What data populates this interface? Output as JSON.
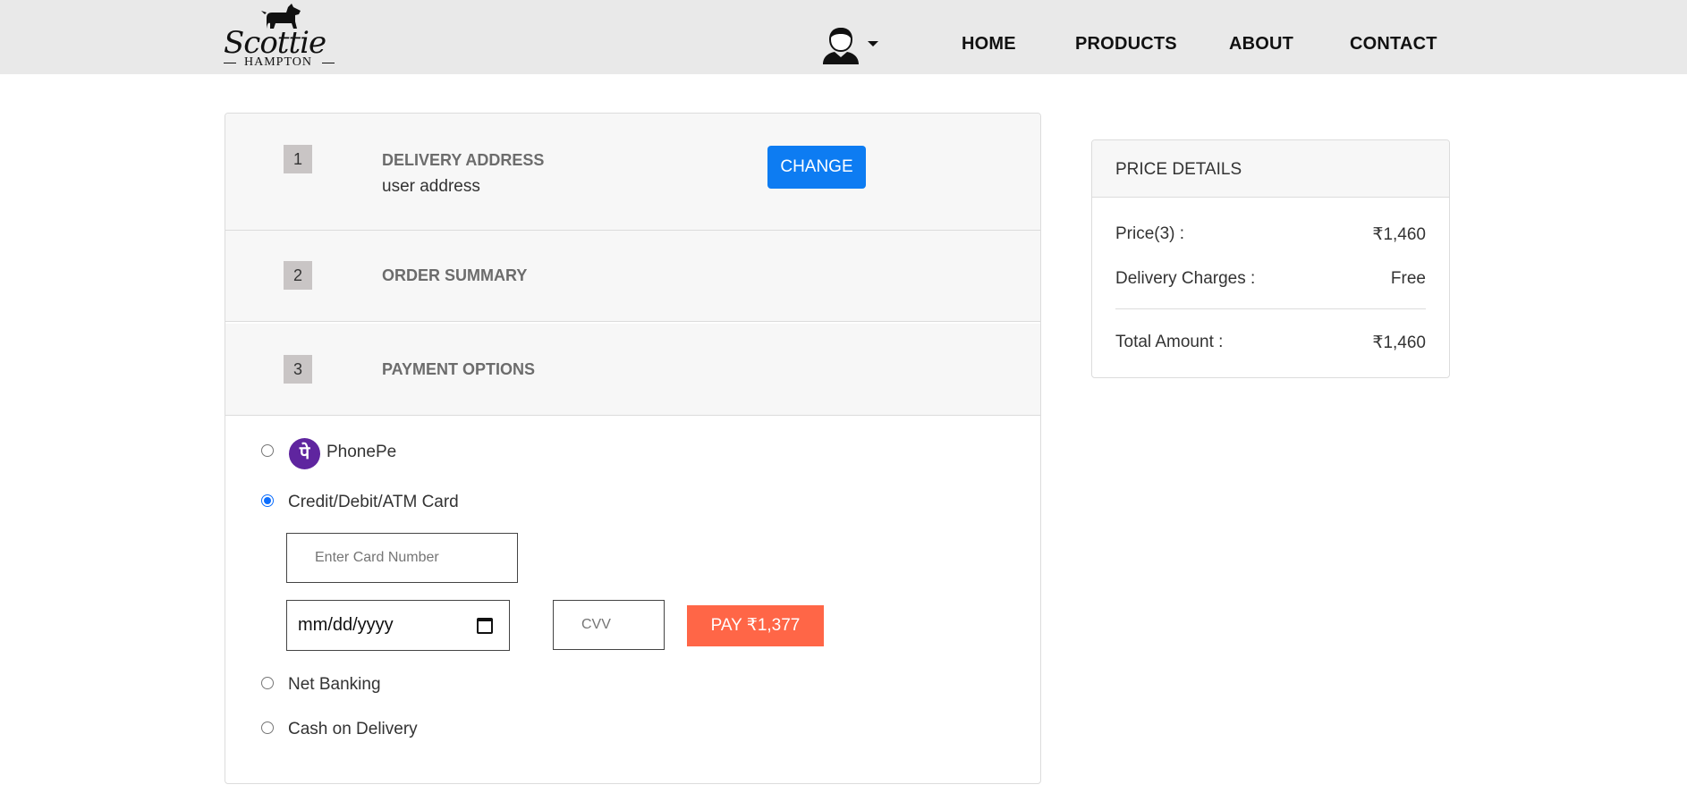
{
  "header": {
    "logo": {
      "script": "Scottie",
      "sub": "HAMPTON"
    },
    "nav": [
      "HOME",
      "PRODUCTS",
      "ABOUT",
      "CONTACT"
    ]
  },
  "checkout": {
    "steps": [
      {
        "number": "1",
        "title": "DELIVERY ADDRESS",
        "subtitle": "user address",
        "action_label": "CHANGE"
      },
      {
        "number": "2",
        "title": "ORDER SUMMARY"
      },
      {
        "number": "3",
        "title": "PAYMENT OPTIONS"
      }
    ],
    "payment": {
      "options": [
        {
          "label": "PhonePe",
          "selected": false,
          "logo_char": "पे"
        },
        {
          "label": "Credit/Debit/ATM Card",
          "selected": true
        },
        {
          "label": "Net Banking",
          "selected": false
        },
        {
          "label": "Cash on Delivery",
          "selected": false
        }
      ],
      "card_number_placeholder": "Enter Card Number",
      "expiry_value": "mm/dd/yyyy",
      "cvv_placeholder": "CVV",
      "pay_label": "PAY ₹1,377"
    }
  },
  "price_details": {
    "title": "PRICE DETAILS",
    "rows": [
      {
        "label": "Price(3) :",
        "value": "₹1,460"
      },
      {
        "label": "Delivery Charges :",
        "value": "Free"
      }
    ],
    "total": {
      "label": "Total Amount :",
      "value": "₹1,460"
    }
  },
  "colors": {
    "primary_button": "#0d7cf2",
    "pay_button": "#ff6647",
    "phonepe": "#5f259f",
    "header_bg": "#e9e9e9"
  },
  "icons": [
    "scottie-dog-logo-icon",
    "user-avatar-icon",
    "caret-down-icon",
    "calendar-icon",
    "phonepe-logo-icon"
  ]
}
